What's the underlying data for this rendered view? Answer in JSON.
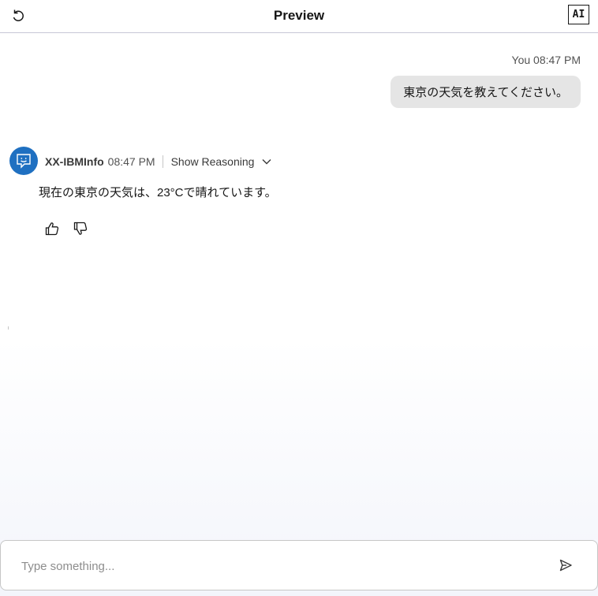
{
  "header": {
    "title": "Preview",
    "ai_badge": "AI",
    "restart_icon": "restart-icon"
  },
  "user_message": {
    "author": "You",
    "time": "08:47 PM",
    "meta": "You 08:47 PM",
    "text": "東京の天気を教えてください。"
  },
  "bot_message": {
    "avatar_icon": "chat-bot-icon",
    "name": "XX-IBMInfo",
    "time": "08:47 PM",
    "reasoning_label": "Show Reasoning",
    "text": "現在の東京の天気は、23°Cで晴れています。",
    "feedback": {
      "up_icon": "thumbs-up-icon",
      "down_icon": "thumbs-down-icon"
    }
  },
  "composer": {
    "placeholder": "Type something...",
    "send_icon": "send-icon"
  },
  "colors": {
    "avatar": "#1f70c1",
    "user_bubble": "#e5e5e5",
    "header_border": "#c6c6d6"
  }
}
